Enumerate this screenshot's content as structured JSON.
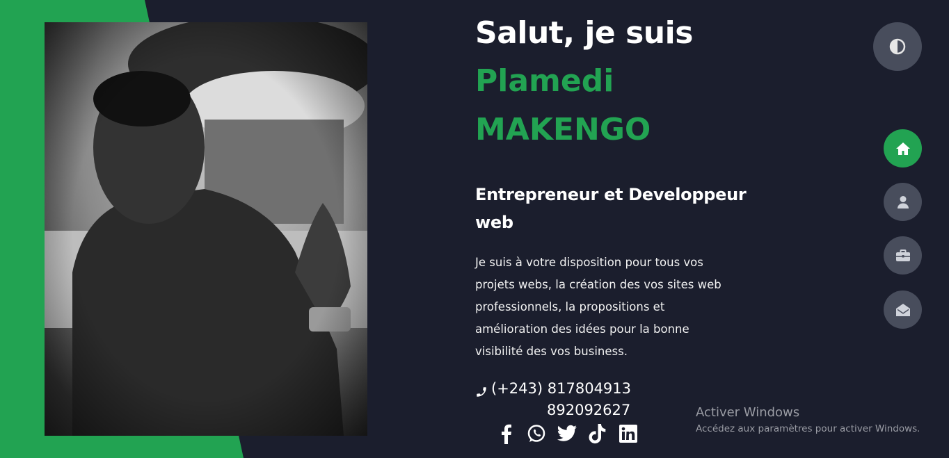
{
  "hero": {
    "greeting": "Salut, je suis",
    "first_name": "Plamedi",
    "last_name": "MAKENGO",
    "role": "Entrepreneur et Developpeur web",
    "description": "Je suis à votre disposition pour tous vos projets webs, la création des vos sites web professionnels, la propositions et amélioration des idées pour la bonne visibilité des vos business.",
    "phone_prefix": "(+243)",
    "phone1": "817804913",
    "phone2": "892092627"
  },
  "socials": [
    "facebook-icon",
    "whatsapp-icon",
    "twitter-icon",
    "tiktok-icon",
    "linkedin-icon"
  ],
  "nav": [
    "home-icon",
    "user-icon",
    "briefcase-icon",
    "envelope-open-icon"
  ],
  "colors": {
    "accent": "#22a352",
    "background": "#1b1e2d",
    "button": "#484d5c"
  },
  "watermark": {
    "title": "Activer Windows",
    "subtitle": "Accédez aux paramètres pour activer Windows."
  }
}
